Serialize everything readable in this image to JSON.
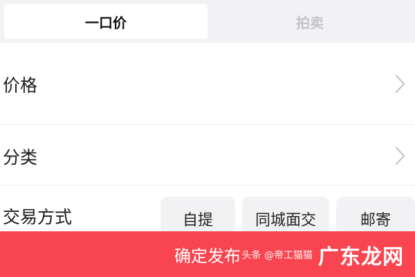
{
  "tabs": [
    {
      "label": "一口价",
      "active": true
    },
    {
      "label": "拍卖",
      "active": false
    }
  ],
  "form": {
    "price_label": "价格",
    "category_label": "分类",
    "trade_method_label": "交易方式",
    "trade_options": [
      "自提",
      "同城面交",
      "邮寄"
    ]
  },
  "publish_button": "确定发布",
  "watermark": {
    "source": "头条 @帝工猫猫",
    "brand": "广东龙网"
  },
  "colors": {
    "accent": "#f9454f",
    "tab_background": "#f2f2f4",
    "inactive_text": "#c4c4c8"
  },
  "icons": {
    "chevron": "chevron-right-icon"
  }
}
